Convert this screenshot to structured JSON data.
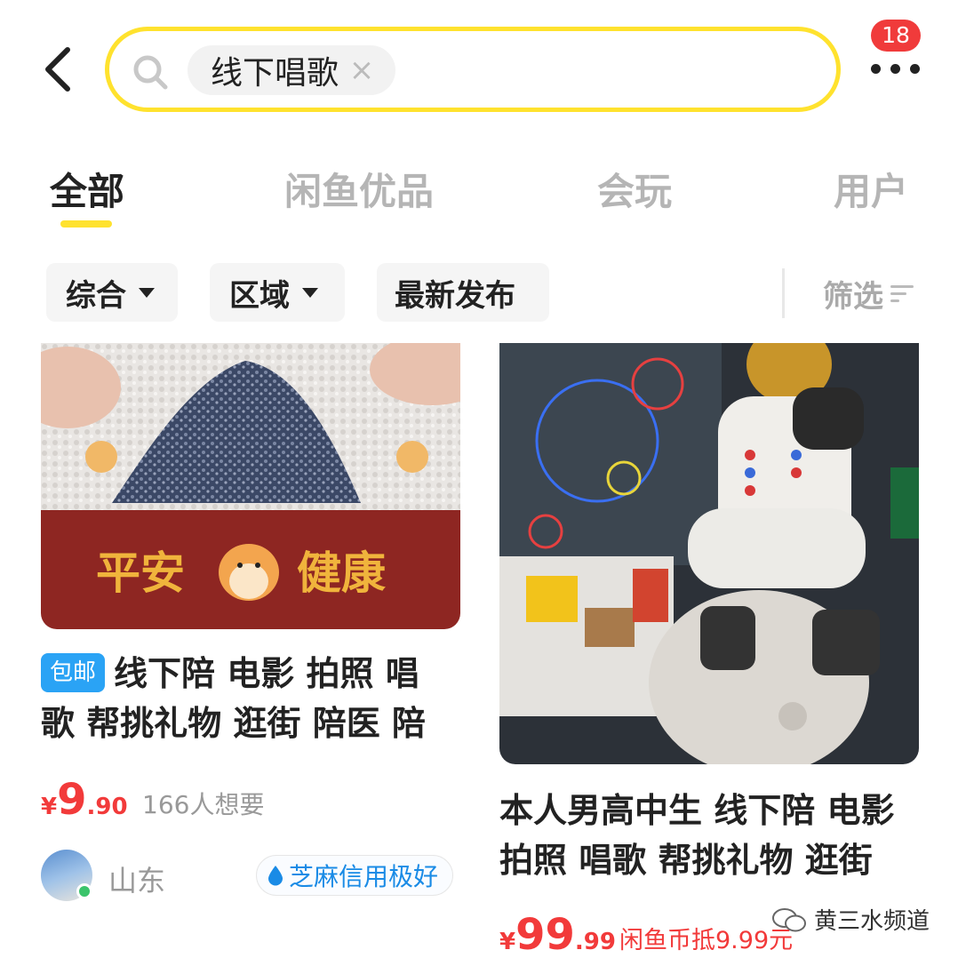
{
  "header": {
    "search_query": "线下唱歌",
    "clear_glyph": "×",
    "badge_count": "18",
    "accent_color": "#ffe22e",
    "badge_color": "#f03b3b"
  },
  "tabs": [
    {
      "label": "全部",
      "active": true
    },
    {
      "label": "闲鱼优品",
      "active": false
    },
    {
      "label": "会玩",
      "active": false
    },
    {
      "label": "用户",
      "active": false
    }
  ],
  "filters": {
    "sort": "综合",
    "region": "区域",
    "latest": "最新发布",
    "screen": "筛选"
  },
  "items": [
    {
      "tag": "包邮",
      "title": "线下陪 电影 拍照 唱歌 帮挑礼物 逛街 陪医 陪",
      "image_text_left": "平安",
      "image_text_right": "健康",
      "price_symbol": "¥",
      "price_int": "9",
      "price_dec": ".90",
      "want_count": "166人想要",
      "seller_region": "山东",
      "credit_label": "芝麻信用极好"
    },
    {
      "title": "本人男高中生 线下陪 电影 拍照 唱歌 帮挑礼物 逛街",
      "price_symbol": "¥",
      "price_int": "99",
      "price_dec": ".99",
      "coin_note": "闲鱼币抵9.99元"
    }
  ],
  "watermark": "黄三水频道",
  "colors": {
    "price": "#f23a3a",
    "tag_blue": "#2aa3f5",
    "credit_blue": "#1a8be6",
    "card1_banner": "#8e2622"
  }
}
